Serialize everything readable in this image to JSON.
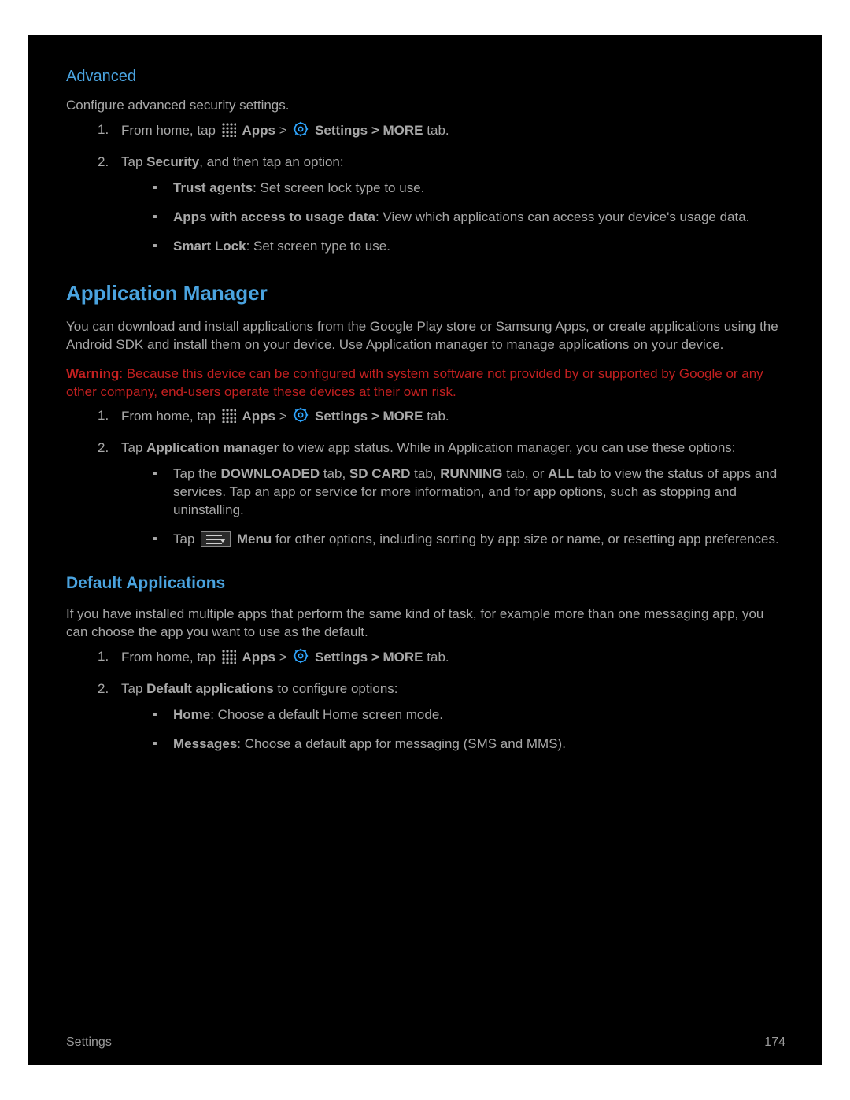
{
  "advanced": {
    "title": "Advanced",
    "intro": "Configure advanced security settings.",
    "step1_a": "From home, tap ",
    "apps": "Apps",
    "gt": " > ",
    "settings": "Settings",
    "more_b": " > MORE",
    "tab_tail": " tab.",
    "step2_a": "Tap ",
    "step2_b": "Security",
    "step2_c": ", and then tap an option:",
    "opt1_b": "Trust agents",
    "opt1_t": ": Set screen lock type to use.",
    "opt2_b": "Apps with access to usage data",
    "opt2_t": ": View which applications can access your device's usage data.",
    "opt3_b": "Smart Lock",
    "opt3_t": ": Set screen type to use."
  },
  "appmgr": {
    "title": "Application Manager",
    "intro": "You can download and install applications from the Google Play store or Samsung Apps, or create applications using the Android SDK and install them on your device. Use Application manager to manage applications on your device.",
    "warn_pre": "Warning",
    "warn": ": Because this device can be configured with system software not provided by or supported by Google or any other company, end-users operate these devices at their own risk.",
    "step2_a": "Tap ",
    "step2_b": "Application manager",
    "step2_c": " to view app status. While in Application manager, you can use these options:",
    "sub1_a": "Tap the ",
    "dl": "DOWNLOADED",
    "sd_pre": " tab, ",
    "sd": "SD CARD",
    "run_pre": " tab, ",
    "run": "RUNNING",
    "all_pre": " tab, or ",
    "all": "ALL",
    "sub1_b": " tab to view the status of apps and services. Tap an app or service for more information, and for app options, such as stopping and uninstalling.",
    "sub2_a": "Tap ",
    "menu": "Menu",
    "sub2_b": " for other options, including sorting by app size or name, or resetting app preferences."
  },
  "defapps": {
    "title": "Default Applications",
    "intro": "If you have installed multiple apps that perform the same kind of task, for example more than one messaging app, you can choose the app you want to use as the default.",
    "step2_a": "Tap ",
    "step2_b": "Default applications",
    "step2_c": " to configure options:",
    "opt1_b": "Home",
    "opt1_t": ": Choose a default Home screen mode.",
    "opt2_b": "Messages",
    "opt2_t": ": Choose a default app for messaging (SMS and MMS)."
  },
  "footer": {
    "left": "Settings",
    "right": "174"
  }
}
